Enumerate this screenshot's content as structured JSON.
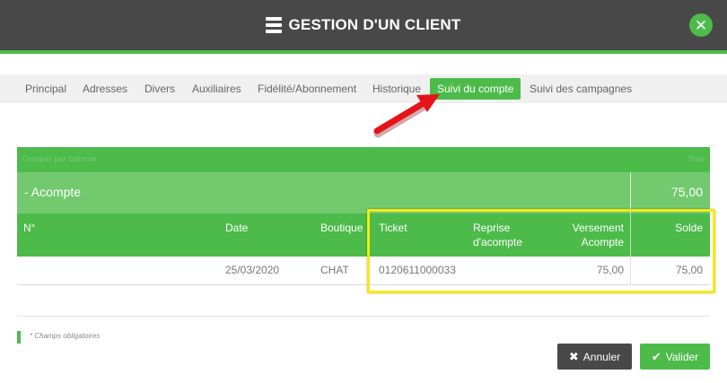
{
  "dialog": {
    "title": "GESTION D'UN CLIENT",
    "close_glyph": "✕",
    "icon": "server-stack-icon"
  },
  "tabs": [
    {
      "label": "Principal"
    },
    {
      "label": "Adresses"
    },
    {
      "label": "Divers"
    },
    {
      "label": "Auxiliaires"
    },
    {
      "label": "Fidélité/Abonnement"
    },
    {
      "label": "Historique"
    },
    {
      "label": "Suivi du compte",
      "active": true
    },
    {
      "label": "Suivi des campagnes"
    }
  ],
  "table": {
    "top_bar": {
      "left_text": "Grouper par colonne",
      "right_text": "Total"
    },
    "group": {
      "toggle": "-",
      "label": "Acompte",
      "total": "75,00"
    },
    "columns": {
      "num": "N°",
      "date": "Date",
      "boutique": "Boutique",
      "ticket": "Ticket",
      "reprise_1": "Reprise",
      "reprise_2": "d'acompte",
      "versement_1": "Versement",
      "versement_2": "Acompte",
      "solde": "Solde"
    },
    "rows": [
      {
        "num": "",
        "date": "25/03/2020",
        "boutique": "CHAT",
        "ticket": "0120611000033",
        "reprise": "",
        "versement": "75,00",
        "solde": "75,00"
      }
    ]
  },
  "footer": {
    "required_note": "* Champs obligatoires",
    "cancel_label": "Annuler",
    "ok_label": "Valider"
  },
  "colors": {
    "accent": "#4cbb4a",
    "header": "#484848",
    "highlight": "#f5ea12",
    "arrow": "#e5141b"
  }
}
